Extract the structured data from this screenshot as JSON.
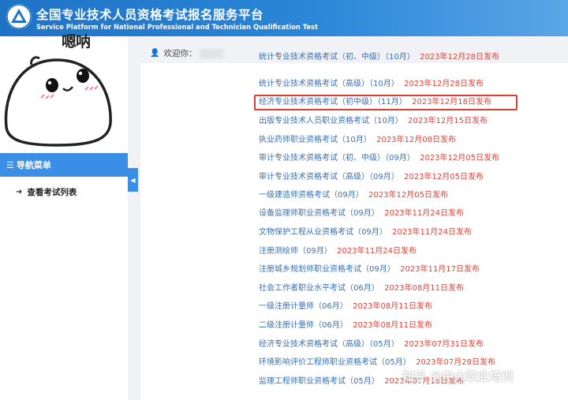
{
  "header": {
    "title": "全国专业技术人员资格考试报名服务平台",
    "subtitle": "Service Platform for National Professional and Technician Qualification Test"
  },
  "mascot": {
    "label": "嗯呐"
  },
  "sidebar": {
    "menu_title": "导航菜单",
    "items": [
      {
        "label": "查看考试列表"
      }
    ]
  },
  "welcome": {
    "label": "欢迎你："
  },
  "exams": [
    {
      "name": "统计专业技术资格考试（初、中级）",
      "session": "（10月）",
      "date": "2023年12月28日发布"
    },
    {
      "name": "统计专业技术资格考试（高级）",
      "session": "（10月）",
      "date": "2023年12月28日发布"
    },
    {
      "name": "经济专业技术资格考试（初中级）",
      "session": "（11月）",
      "date": "2023年12月18日发布"
    },
    {
      "name": "出版专业技术人员职业资格考试",
      "session": "（10月）",
      "date": "2023年12月15日发布"
    },
    {
      "name": "执业药师职业资格考试",
      "session": "（10月）",
      "date": "2023年12月08日发布"
    },
    {
      "name": "审计专业技术资格考试（初、中级）",
      "session": "（09月）",
      "date": "2023年12月05日发布"
    },
    {
      "name": "审计专业技术资格考试（高级）",
      "session": "（09月）",
      "date": "2023年12月05日发布"
    },
    {
      "name": "一级建造师资格考试",
      "session": "（09月）",
      "date": "2023年12月05日发布"
    },
    {
      "name": "设备监理师职业资格考试",
      "session": "（09月）",
      "date": "2023年11月24日发布"
    },
    {
      "name": "文物保护工程从业资格考试",
      "session": "（09月）",
      "date": "2023年11月24日发布"
    },
    {
      "name": "注册测绘师",
      "session": "（09月）",
      "date": "2023年11月24日发布"
    },
    {
      "name": "注册城乡规划师职业资格考试",
      "session": "（09月）",
      "date": "2023年11月17日发布"
    },
    {
      "name": "社会工作者职业水平考试",
      "session": "（06月）",
      "date": "2023年08月11日发布"
    },
    {
      "name": "一级注册计量师",
      "session": "（06月）",
      "date": "2023年08月11日发布"
    },
    {
      "name": "二级注册计量师",
      "session": "（06月）",
      "date": "2023年08月11日发布"
    },
    {
      "name": "经济专业技术资格考试（高级）",
      "session": "（05月）",
      "date": "2023年07月31日发布"
    },
    {
      "name": "环境影响评价工程师职业资格考试",
      "session": "（05月）",
      "date": "2023年07月28日发布"
    },
    {
      "name": "监理工程师职业资格考试",
      "session": "（05月）",
      "date": "2023年07月18日发布"
    }
  ],
  "watermark": "知乎 @中大职业培训",
  "colors": {
    "header_blue": "#1f73c6",
    "menu_blue": "#3a8ee6",
    "link_blue": "#3b6fb0",
    "date_red": "#e0433a",
    "highlight_red": "#e23b31"
  },
  "icons": {
    "logo": "triangle-emblem-icon",
    "menu": "list-icon",
    "nav_item": "arrow-right-circle-icon",
    "collapse": "caret-left-icon",
    "user": "user-icon"
  }
}
